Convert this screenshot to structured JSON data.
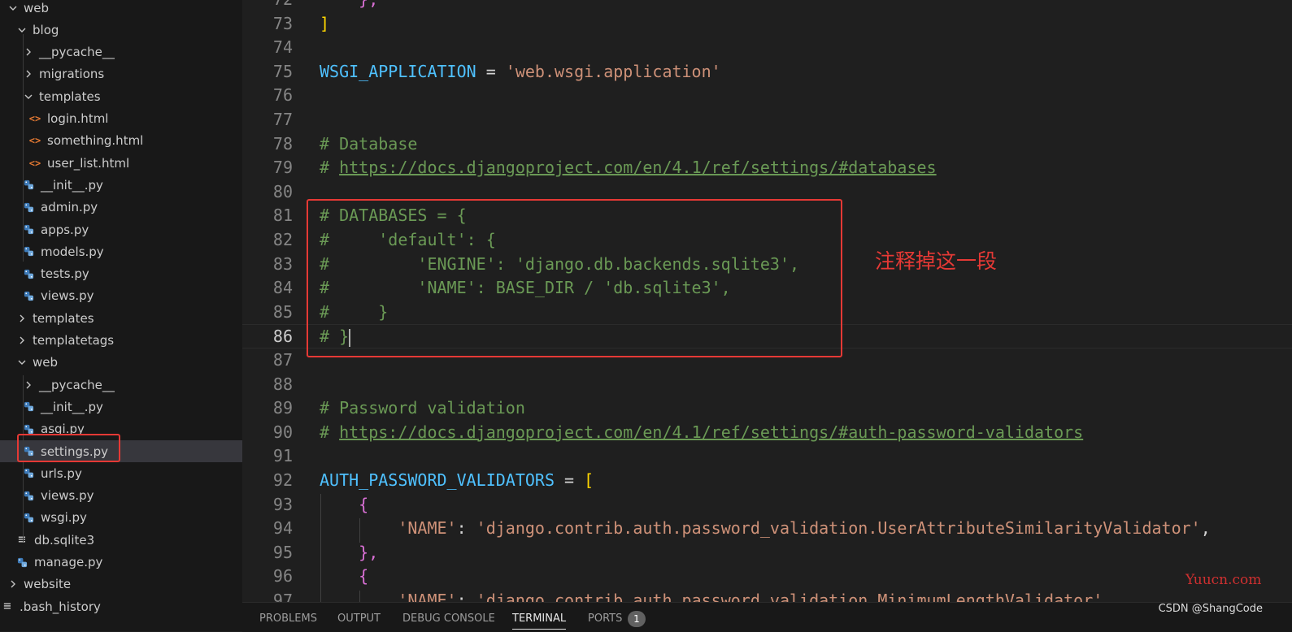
{
  "explorer": {
    "items": [
      {
        "label": "web",
        "kind": "folder-open",
        "depth": 0
      },
      {
        "label": "blog",
        "kind": "folder-open",
        "depth": 1
      },
      {
        "label": "__pycache__",
        "kind": "folder-closed",
        "depth": 2
      },
      {
        "label": "migrations",
        "kind": "folder-closed",
        "depth": 2
      },
      {
        "label": "templates",
        "kind": "folder-open",
        "depth": 2
      },
      {
        "label": "login.html",
        "kind": "html",
        "depth": 3
      },
      {
        "label": "something.html",
        "kind": "html",
        "depth": 3
      },
      {
        "label": "user_list.html",
        "kind": "html",
        "depth": 3
      },
      {
        "label": "__init__.py",
        "kind": "py",
        "depth": 2
      },
      {
        "label": "admin.py",
        "kind": "py",
        "depth": 2
      },
      {
        "label": "apps.py",
        "kind": "py",
        "depth": 2
      },
      {
        "label": "models.py",
        "kind": "py",
        "depth": 2
      },
      {
        "label": "tests.py",
        "kind": "py",
        "depth": 2
      },
      {
        "label": "views.py",
        "kind": "py",
        "depth": 2
      },
      {
        "label": "templates",
        "kind": "folder-closed",
        "depth": 1
      },
      {
        "label": "templatetags",
        "kind": "folder-closed",
        "depth": 1
      },
      {
        "label": "web",
        "kind": "folder-open",
        "depth": 1
      },
      {
        "label": "__pycache__",
        "kind": "folder-closed",
        "depth": 2
      },
      {
        "label": "__init__.py",
        "kind": "py",
        "depth": 2
      },
      {
        "label": "asgi.py",
        "kind": "py",
        "depth": 2
      },
      {
        "label": "settings.py",
        "kind": "py",
        "depth": 2,
        "selected": true
      },
      {
        "label": "urls.py",
        "kind": "py",
        "depth": 2
      },
      {
        "label": "views.py",
        "kind": "py",
        "depth": 2
      },
      {
        "label": "wsgi.py",
        "kind": "py",
        "depth": 2
      },
      {
        "label": "db.sqlite3",
        "kind": "db",
        "depth": 1
      },
      {
        "label": "manage.py",
        "kind": "py",
        "depth": 1
      },
      {
        "label": "website",
        "kind": "folder-closed",
        "depth": 0
      },
      {
        "label": ".bash_history",
        "kind": "lines",
        "depth": -1
      }
    ]
  },
  "editor": {
    "current_line": 86,
    "lines": [
      {
        "n": "72",
        "tokens": [
          {
            "t": "    ",
            "c": ""
          },
          {
            "t": "},",
            "c": "c-br2"
          }
        ]
      },
      {
        "n": "73",
        "tokens": [
          {
            "t": "]",
            "c": "c-br1"
          }
        ]
      },
      {
        "n": "74",
        "tokens": []
      },
      {
        "n": "75",
        "tokens": [
          {
            "t": "WSGI_APPLICATION",
            "c": "c-var"
          },
          {
            "t": " = ",
            "c": "c-op"
          },
          {
            "t": "'web.wsgi.application'",
            "c": "c-str"
          }
        ]
      },
      {
        "n": "76",
        "tokens": []
      },
      {
        "n": "77",
        "tokens": []
      },
      {
        "n": "78",
        "tokens": [
          {
            "t": "# Database",
            "c": "c-com"
          }
        ]
      },
      {
        "n": "79",
        "tokens": [
          {
            "t": "# ",
            "c": "c-com"
          },
          {
            "t": "https://docs.djangoproject.com/en/4.1/ref/settings/#databases",
            "c": "c-link"
          }
        ]
      },
      {
        "n": "80",
        "tokens": []
      },
      {
        "n": "81",
        "tokens": [
          {
            "t": "# DATABASES = {",
            "c": "c-com"
          }
        ]
      },
      {
        "n": "82",
        "tokens": [
          {
            "t": "#     'default': {",
            "c": "c-com"
          }
        ]
      },
      {
        "n": "83",
        "tokens": [
          {
            "t": "#         'ENGINE': 'django.db.backends.sqlite3',",
            "c": "c-com"
          }
        ]
      },
      {
        "n": "84",
        "tokens": [
          {
            "t": "#         'NAME': BASE_DIR / 'db.sqlite3',",
            "c": "c-com"
          }
        ]
      },
      {
        "n": "85",
        "tokens": [
          {
            "t": "#     }",
            "c": "c-com"
          }
        ]
      },
      {
        "n": "86",
        "tokens": [
          {
            "t": "# }",
            "c": "c-com"
          }
        ],
        "cursor": true
      },
      {
        "n": "87",
        "tokens": []
      },
      {
        "n": "88",
        "tokens": []
      },
      {
        "n": "89",
        "tokens": [
          {
            "t": "# Password validation",
            "c": "c-com"
          }
        ]
      },
      {
        "n": "90",
        "tokens": [
          {
            "t": "# ",
            "c": "c-com"
          },
          {
            "t": "https://docs.djangoproject.com/en/4.1/ref/settings/#auth-password-validators",
            "c": "c-link"
          }
        ]
      },
      {
        "n": "91",
        "tokens": []
      },
      {
        "n": "92",
        "tokens": [
          {
            "t": "AUTH_PASSWORD_VALIDATORS",
            "c": "c-var"
          },
          {
            "t": " = ",
            "c": "c-op"
          },
          {
            "t": "[",
            "c": "c-br1"
          }
        ]
      },
      {
        "n": "93",
        "tokens": [
          {
            "t": "    ",
            "c": ""
          },
          {
            "t": "{",
            "c": "c-br2"
          }
        ]
      },
      {
        "n": "94",
        "tokens": [
          {
            "t": "        ",
            "c": ""
          },
          {
            "t": "'NAME'",
            "c": "c-str"
          },
          {
            "t": ": ",
            "c": "c-op"
          },
          {
            "t": "'django.contrib.auth.password_validation.UserAttributeSimilarityValidator'",
            "c": "c-str"
          },
          {
            "t": ",",
            "c": "c-op"
          }
        ]
      },
      {
        "n": "95",
        "tokens": [
          {
            "t": "    ",
            "c": ""
          },
          {
            "t": "},",
            "c": "c-br2"
          }
        ]
      },
      {
        "n": "96",
        "tokens": [
          {
            "t": "    ",
            "c": ""
          },
          {
            "t": "{",
            "c": "c-br2"
          }
        ]
      },
      {
        "n": "97",
        "tokens": [
          {
            "t": "        ",
            "c": ""
          },
          {
            "t": "'NAME'",
            "c": "c-str"
          },
          {
            "t": ": ",
            "c": "c-op"
          },
          {
            "t": "'django.contrib.auth.password_validation.MinimumLengthValidator'",
            "c": "c-str"
          },
          {
            "t": ",",
            "c": "c-op"
          }
        ]
      }
    ]
  },
  "annotation": {
    "text": "注释掉这一段"
  },
  "panel": {
    "tabs": [
      "PROBLEMS",
      "OUTPUT",
      "DEBUG CONSOLE",
      "TERMINAL",
      "PORTS"
    ],
    "active_tab": "TERMINAL",
    "ports_badge": "1"
  },
  "watermarks": {
    "yuucn": "Yuucn.com",
    "csdn": "CSDN @ShangCode"
  },
  "colors": {
    "annotation_red": "#e53935",
    "comment_green": "#6a9955",
    "string_orange": "#ce9178",
    "variable_blue": "#4fc1ff"
  }
}
